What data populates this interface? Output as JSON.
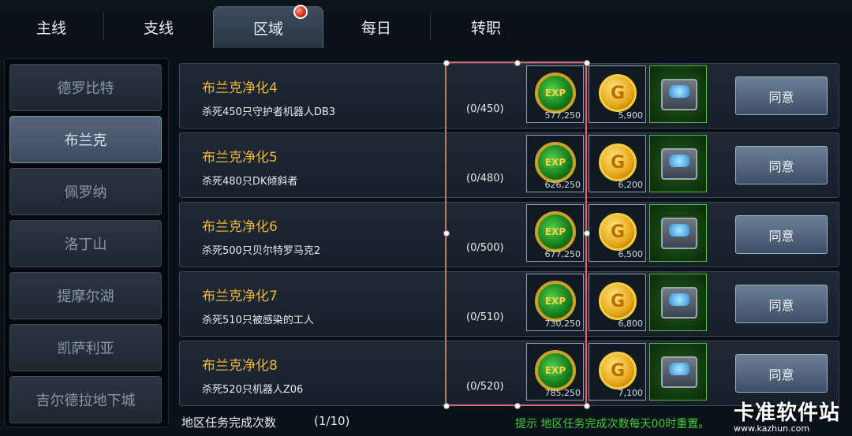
{
  "tabs": [
    {
      "label": "主线",
      "active": false
    },
    {
      "label": "支线",
      "active": false
    },
    {
      "label": "区域",
      "active": true,
      "has_notification": true
    },
    {
      "label": "每日",
      "active": false
    },
    {
      "label": "转职",
      "active": false
    }
  ],
  "regions": [
    {
      "label": "德罗比特",
      "active": false
    },
    {
      "label": "布兰克",
      "active": true
    },
    {
      "label": "佩罗纳",
      "active": false
    },
    {
      "label": "洛丁山",
      "active": false
    },
    {
      "label": "提摩尔湖",
      "active": false
    },
    {
      "label": "凯萨利亚",
      "active": false
    },
    {
      "label": "吉尔德拉地下城",
      "active": false
    }
  ],
  "quests": [
    {
      "title": "布兰克净化4",
      "description": "杀死450只守护者机器人DB3",
      "progress": "(0/450)",
      "exp": "577,250",
      "gold": "5,900",
      "button": "同意"
    },
    {
      "title": "布兰克净化5",
      "description": "杀死480只DK倾斜者",
      "progress": "(0/480)",
      "exp": "626,250",
      "gold": "6,200",
      "button": "同意"
    },
    {
      "title": "布兰克净化6",
      "description": "杀死500只贝尔特罗马克2",
      "progress": "(0/500)",
      "exp": "677,250",
      "gold": "6,500",
      "button": "同意"
    },
    {
      "title": "布兰克净化7",
      "description": "杀死510只被感染的工人",
      "progress": "(0/510)",
      "exp": "730,250",
      "gold": "6,800",
      "button": "同意"
    },
    {
      "title": "布兰克净化8",
      "description": "杀死520只机器人Z06",
      "progress": "(0/520)",
      "exp": "785,250",
      "gold": "7,100",
      "button": "同意"
    }
  ],
  "icons": {
    "exp_label": "EXP",
    "gold_label": "G"
  },
  "footer": {
    "label": "地区任务完成次数",
    "count": "(1/10)",
    "tip": "提示 地区任务完成次数每天00时重置。"
  },
  "watermark": {
    "text": "卡准软件站",
    "url": "www.kazhun.com"
  },
  "colors": {
    "quest_title": "#f0b43c",
    "tip": "#3fcf35",
    "selection": "#d9686e"
  }
}
